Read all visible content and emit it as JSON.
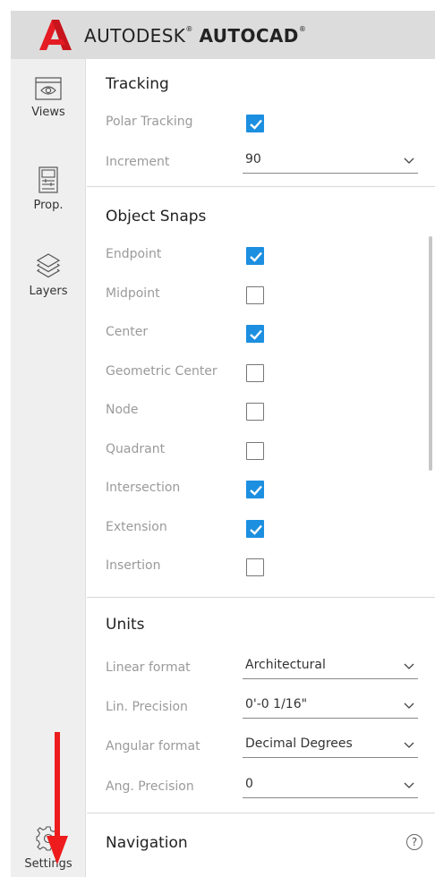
{
  "header": {
    "brand_light": "AUTODESK",
    "brand_bold": "AUTOCAD",
    "reg_mark": "®",
    "logo_icon": "autodesk-a-logo",
    "logo_color": "#e51b24"
  },
  "sidebar": {
    "items": [
      {
        "label": "Views",
        "icon": "eye-icon"
      },
      {
        "label": "Prop.",
        "icon": "properties-icon"
      },
      {
        "label": "Layers",
        "icon": "layers-icon"
      },
      {
        "label": "Settings",
        "icon": "gear-icon"
      }
    ]
  },
  "tracking": {
    "title": "Tracking",
    "polar_label": "Polar Tracking",
    "polar_checked": true,
    "increment_label": "Increment",
    "increment_value": "90"
  },
  "snaps": {
    "title": "Object Snaps",
    "items": [
      {
        "label": "Endpoint",
        "checked": true
      },
      {
        "label": "Midpoint",
        "checked": false
      },
      {
        "label": "Center",
        "checked": true
      },
      {
        "label": "Geometric Center",
        "checked": false
      },
      {
        "label": "Node",
        "checked": false
      },
      {
        "label": "Quadrant",
        "checked": false
      },
      {
        "label": "Intersection",
        "checked": true
      },
      {
        "label": "Extension",
        "checked": true
      },
      {
        "label": "Insertion",
        "checked": false
      }
    ]
  },
  "units": {
    "title": "Units",
    "rows": [
      {
        "label": "Linear format",
        "value": "Architectural"
      },
      {
        "label": "Lin. Precision",
        "value": "0'-0 1/16\""
      },
      {
        "label": "Angular format",
        "value": "Decimal Degrees"
      },
      {
        "label": "Ang. Precision",
        "value": "0"
      }
    ]
  },
  "navigation": {
    "title": "Navigation",
    "help_glyph": "?"
  },
  "colors": {
    "accent": "#1d8fe0",
    "annotation_arrow": "#ee1c1c"
  }
}
